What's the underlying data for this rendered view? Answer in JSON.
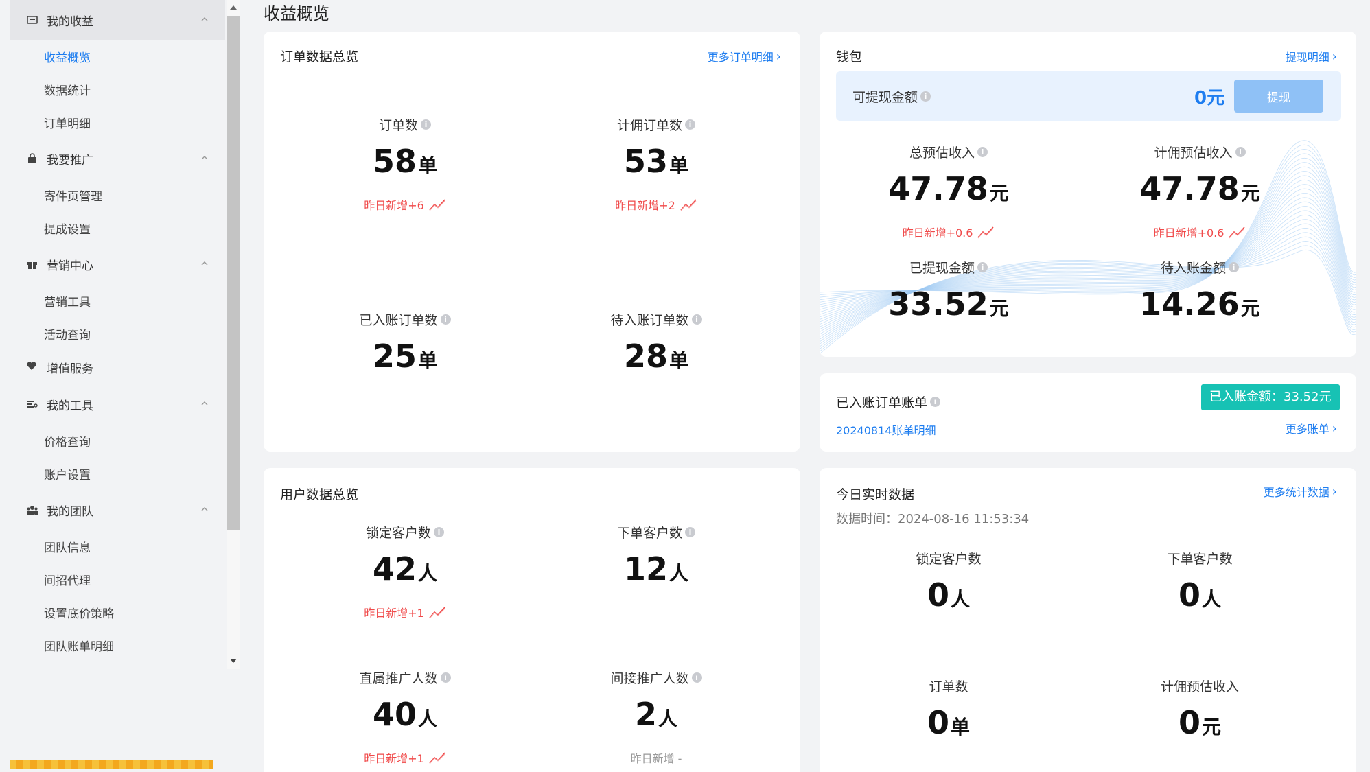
{
  "sidebar": {
    "groups": [
      {
        "label": "我的收益",
        "items": [
          "收益概览",
          "数据统计",
          "订单明细"
        ]
      },
      {
        "label": "我要推广",
        "items": [
          "寄件页管理",
          "提成设置"
        ]
      },
      {
        "label": "营销中心",
        "items": [
          "营销工具",
          "活动查询"
        ]
      },
      {
        "label": "增值服务"
      },
      {
        "label": "我的工具",
        "items": [
          "价格查询",
          "账户设置"
        ]
      },
      {
        "label": "我的团队",
        "items": [
          "团队信息",
          "间招代理",
          "设置底价策略",
          "团队账单明细"
        ]
      }
    ]
  },
  "page": {
    "title": "收益概览"
  },
  "orders": {
    "title": "订单数据总览",
    "more": "更多订单明细",
    "stats": [
      {
        "label": "订单数",
        "value": "58",
        "unit": "单",
        "delta": "昨日新增+6"
      },
      {
        "label": "计佣订单数",
        "value": "53",
        "unit": "单",
        "delta": "昨日新增+2"
      },
      {
        "label": "已入账订单数",
        "value": "25",
        "unit": "单"
      },
      {
        "label": "待入账订单数",
        "value": "28",
        "unit": "单"
      }
    ]
  },
  "wallet": {
    "title": "钱包",
    "more": "提现明细",
    "withdrawable_label": "可提现金额",
    "withdrawable_value": "0元",
    "withdraw_button": "提现",
    "stats": [
      {
        "label": "总预估收入",
        "value": "47.78",
        "unit": "元",
        "delta": "昨日新增+0.6"
      },
      {
        "label": "计佣预估收入",
        "value": "47.78",
        "unit": "元",
        "delta": "昨日新增+0.6"
      },
      {
        "label": "已提现金额",
        "value": "33.52",
        "unit": "元"
      },
      {
        "label": "待入账金额",
        "value": "14.26",
        "unit": "元"
      }
    ]
  },
  "bill": {
    "title": "已入账订单账单",
    "badge": "已入账金额：33.52元",
    "date_link": "20240814账单明细",
    "more": "更多账单"
  },
  "users": {
    "title": "用户数据总览",
    "stats": [
      {
        "label": "锁定客户数",
        "value": "42",
        "unit": "人",
        "delta": "昨日新增+1"
      },
      {
        "label": "下单客户数",
        "value": "12",
        "unit": "人"
      },
      {
        "label": "直属推广人数",
        "value": "40",
        "unit": "人",
        "delta": "昨日新增+1"
      },
      {
        "label": "间接推广人数",
        "value": "2",
        "unit": "人",
        "delta": "昨日新增 -"
      }
    ]
  },
  "realtime": {
    "title": "今日实时数据",
    "more": "更多统计数据",
    "timestamp": "数据时间：2024-08-16 11:53:34",
    "stats": [
      {
        "label": "锁定客户数",
        "value": "0",
        "unit": "人"
      },
      {
        "label": "下单客户数",
        "value": "0",
        "unit": "人"
      },
      {
        "label": "订单数",
        "value": "0",
        "unit": "单"
      },
      {
        "label": "计佣预估收入",
        "value": "0",
        "unit": "元"
      }
    ]
  },
  "colors": {
    "accent": "#1d7df0",
    "up": "#f04a4a",
    "badge": "#17c2b4"
  }
}
